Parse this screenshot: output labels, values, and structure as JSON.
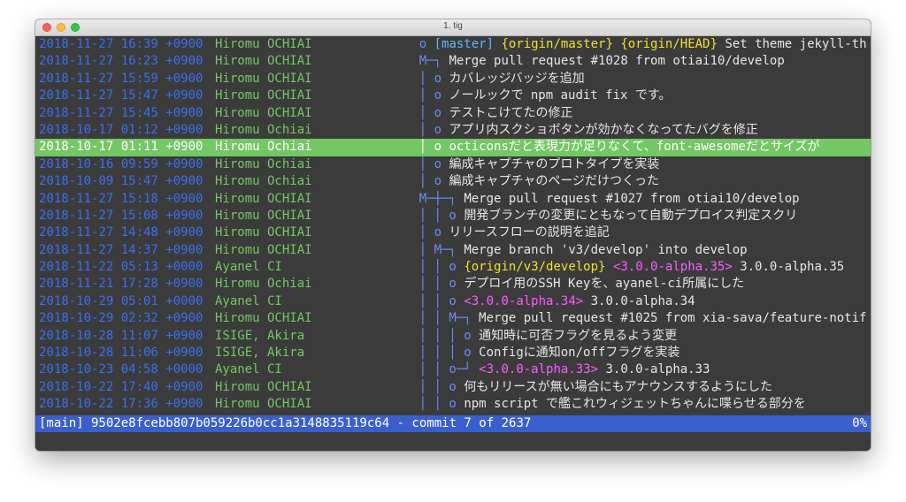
{
  "window": {
    "title": "1. tig"
  },
  "rows": [
    {
      "date": "2018-11-27 16:39 +0900",
      "author": "Hiromu OCHIAI",
      "graph": "o",
      "indent": 1,
      "refs": [
        {
          "t": "[master]",
          "c": "bk"
        },
        {
          "t": "{origin/master}",
          "c": "yl"
        },
        {
          "t": "{origin/HEAD}",
          "c": "yl"
        }
      ],
      "msg": "Set theme jekyll-th"
    },
    {
      "date": "2018-11-27 16:23 +0900",
      "author": "Hiromu OCHIAI",
      "graph": "M─┐",
      "indent": 1,
      "refs": [],
      "msg": "Merge pull request #1028 from otiai10/develop"
    },
    {
      "date": "2018-11-27 15:59 +0900",
      "author": "Hiromu OCHIAI",
      "graph": "│ o",
      "indent": 1,
      "refs": [],
      "msg": "カバレッジバッジを追加"
    },
    {
      "date": "2018-11-27 15:47 +0900",
      "author": "Hiromu OCHIAI",
      "graph": "│ o",
      "indent": 1,
      "refs": [],
      "msg": "ノールックで npm audit fix です。"
    },
    {
      "date": "2018-11-27 15:45 +0900",
      "author": "Hiromu OCHIAI",
      "graph": "│ o",
      "indent": 1,
      "refs": [],
      "msg": "テストこけてたの修正"
    },
    {
      "date": "2018-10-17 01:12 +0900",
      "author": "Hiromu Ochiai",
      "graph": "│ o",
      "indent": 1,
      "refs": [],
      "msg": "アプリ内スクショボタンが効かなくなってたバグを修正"
    },
    {
      "date": "2018-10-17 01:11 +0900",
      "author": "Hiromu Ochiai",
      "graph": "│ o",
      "indent": 1,
      "refs": [],
      "msg": "octiconsだと表現力が足りなくて、font-awesomeだとサイズが",
      "selected": true
    },
    {
      "date": "2018-10-16 09:59 +0900",
      "author": "Hiromu Ochiai",
      "graph": "│ o",
      "indent": 1,
      "refs": [],
      "msg": "編成キャプチャのプロトタイプを実装"
    },
    {
      "date": "2018-10-09 15:47 +0900",
      "author": "Hiromu Ochiai",
      "graph": "│ o",
      "indent": 1,
      "refs": [],
      "msg": "編成キャプチャのページだけつくった"
    },
    {
      "date": "2018-11-27 15:18 +0900",
      "author": "Hiromu OCHIAI",
      "graph": "M─┼─┐",
      "indent": 1,
      "refs": [],
      "msg": "Merge pull request #1027 from otiai10/develop"
    },
    {
      "date": "2018-11-27 15:08 +0900",
      "author": "Hiromu OCHIAI",
      "graph": "│ │ o",
      "indent": 1,
      "refs": [],
      "msg": "開発ブランチの変更にともなって自動デプロイス判定スクリ"
    },
    {
      "date": "2018-11-27 14:48 +0900",
      "author": "Hiromu OCHIAI",
      "graph": "│ o",
      "indent": 1,
      "refs": [],
      "msg": "リリースフローの説明を追記"
    },
    {
      "date": "2018-11-27 14:37 +0900",
      "author": "Hiromu OCHIAI",
      "graph": "│ M─┐",
      "indent": 1,
      "refs": [],
      "msg": "Merge branch 'v3/develop' into develop"
    },
    {
      "date": "2018-11-22 05:13 +0000",
      "author": "Ayanel CI",
      "graph": "│ │ o",
      "indent": 1,
      "refs": [
        {
          "t": "{origin/v3/develop}",
          "c": "yl"
        },
        {
          "t": "<3.0.0-alpha.35>",
          "c": "mg"
        }
      ],
      "msg": "3.0.0-alpha.35"
    },
    {
      "date": "2018-11-21 17:28 +0900",
      "author": "Hiromu Ochiai",
      "graph": "│ │ o",
      "indent": 1,
      "refs": [],
      "msg": "デプロイ用のSSH Keyを、ayanel-ci所属にした"
    },
    {
      "date": "2018-10-29 05:01 +0000",
      "author": "Ayanel CI",
      "graph": "│ │ o",
      "indent": 1,
      "refs": [
        {
          "t": "<3.0.0-alpha.34>",
          "c": "mg"
        }
      ],
      "msg": "3.0.0-alpha.34"
    },
    {
      "date": "2018-10-29 02:32 +0900",
      "author": "Hiromu OCHIAI",
      "graph": "│ │ M─┐",
      "indent": 1,
      "refs": [],
      "msg": "Merge pull request #1025 from xia-sava/feature-notif"
    },
    {
      "date": "2018-10-28 11:07 +0900",
      "author": "ISIGE, Akira",
      "graph": "│ │ │ o",
      "indent": 1,
      "refs": [],
      "msg": "通知時に可否フラグを見るよう変更"
    },
    {
      "date": "2018-10-28 11:06 +0900",
      "author": "ISIGE, Akira",
      "graph": "│ │ │ o",
      "indent": 1,
      "refs": [],
      "msg": "Configに通知on/offフラグを実装"
    },
    {
      "date": "2018-10-23 04:58 +0000",
      "author": "Ayanel CI",
      "graph": "│ │ o─┘",
      "indent": 1,
      "refs": [
        {
          "t": "<3.0.0-alpha.33>",
          "c": "mg"
        }
      ],
      "msg": "3.0.0-alpha.33"
    },
    {
      "date": "2018-10-22 17:40 +0900",
      "author": "Hiromu OCHIAI",
      "graph": "│ │ o",
      "indent": 1,
      "refs": [],
      "msg": "何もリリースが無い場合にもアナウンスするようにした"
    },
    {
      "date": "2018-10-22 17:36 +0900",
      "author": "Hiromu OCHIAI",
      "graph": "│ │ o",
      "indent": 1,
      "refs": [],
      "msg": "npm script で艦これウィジェットちゃんに喋らせる部分を"
    }
  ],
  "status": {
    "left": "[main] 9502e8fcebb807b059226b0cc1a3148835119c64 - commit 7 of 2637",
    "right": "0%"
  },
  "colors": {
    "date": "#3b6ff1",
    "author": "#74c765",
    "selected_bg": "#74c765",
    "status_bg": "#3a5fcd",
    "graph_pink": "#b657b4"
  }
}
